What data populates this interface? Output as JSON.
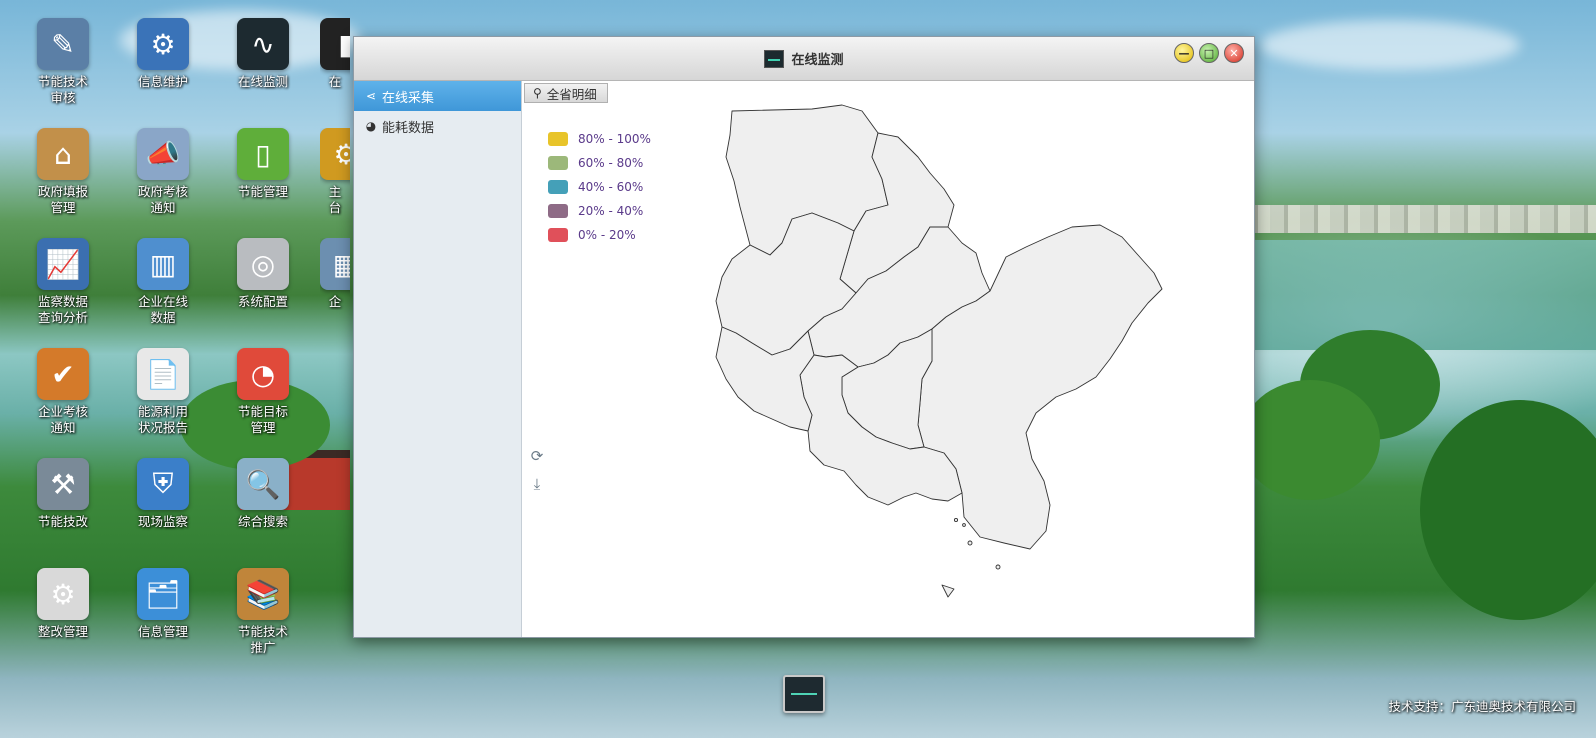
{
  "desktop": {
    "icons": [
      {
        "label": "节能技术\n审核",
        "icon": "document-pen-icon",
        "color": "#5b7fa6",
        "glyph": "✎"
      },
      {
        "label": "信息维护",
        "icon": "gears-icon",
        "color": "#3a73b8",
        "glyph": "⚙"
      },
      {
        "label": "在线监测",
        "icon": "monitor-icon",
        "color": "#1d2a30",
        "glyph": "∿"
      },
      {
        "label": "在",
        "icon": "monitor-icon",
        "color": "#222222",
        "glyph": "▮"
      },
      {
        "label": "政府填报\n管理",
        "icon": "government-building-icon",
        "color": "#c2904a",
        "glyph": "⌂"
      },
      {
        "label": "政府考核\n通知",
        "icon": "megaphone-icon",
        "color": "#8aa6c8",
        "glyph": "📣"
      },
      {
        "label": "节能管理",
        "icon": "battery-icon",
        "color": "#5fae3a",
        "glyph": "▯"
      },
      {
        "label": "主\n台",
        "icon": "gear-icon",
        "color": "#d09a20",
        "glyph": "⚙"
      },
      {
        "label": "监察数据\n查询分析",
        "icon": "chart-monitor-icon",
        "color": "#3b6fb0",
        "glyph": "📈"
      },
      {
        "label": "企业在线\n数据",
        "icon": "bar-chart-icon",
        "color": "#4f8fcf",
        "glyph": "▥"
      },
      {
        "label": "系统配置",
        "icon": "hard-disk-icon",
        "color": "#b9bcc0",
        "glyph": "◎"
      },
      {
        "label": "企",
        "icon": "building-icon",
        "color": "#6c8fb0",
        "glyph": "▦"
      },
      {
        "label": "企业考核\n通知",
        "icon": "clipboard-check-icon",
        "color": "#d47a2a",
        "glyph": "✔"
      },
      {
        "label": "能源利用\n状况报告",
        "icon": "report-chart-icon",
        "color": "#e8e8e8",
        "glyph": "📄"
      },
      {
        "label": "节能目标\n管理",
        "icon": "gauge-icon",
        "color": "#e04a3a",
        "glyph": "◔"
      },
      {
        "label": "节能技改",
        "icon": "tools-icon",
        "color": "#7a8a98",
        "glyph": "⚒"
      },
      {
        "label": "现场监察",
        "icon": "shield-camera-icon",
        "color": "#3b7fc9",
        "glyph": "⛨"
      },
      {
        "label": "综合搜索",
        "icon": "magnifier-icon",
        "color": "#8ab0c8",
        "glyph": "🔍"
      },
      {
        "label": "整改管理",
        "icon": "gear-document-icon",
        "color": "#d9d9d9",
        "glyph": "⚙"
      },
      {
        "label": "信息管理",
        "icon": "folder-cabinet-icon",
        "color": "#3c8fd8",
        "glyph": "🗂"
      },
      {
        "label": "节能技术\n推广",
        "icon": "books-icon",
        "color": "#c0853a",
        "glyph": "📚"
      }
    ]
  },
  "window": {
    "title": "在线监测",
    "title_icon": "monitor-icon",
    "buttons": {
      "minimize": "—",
      "maximize": "□",
      "close": "✕"
    },
    "sidebar": {
      "items": [
        {
          "label": "在线采集",
          "icon": "share-icon",
          "active": true
        },
        {
          "label": "能耗数据",
          "icon": "dashboard-icon",
          "active": false
        }
      ]
    },
    "content": {
      "tab": {
        "label": "全省明细",
        "icon": "search-icon"
      },
      "legend": [
        {
          "label": "80%  -  100%",
          "color": "#e8c42a"
        },
        {
          "label": "60%  -  80%",
          "color": "#9cb87a"
        },
        {
          "label": "40%  -  60%",
          "color": "#44a0b8"
        },
        {
          "label": "20%  -  40%",
          "color": "#8e6b86"
        },
        {
          "label": "0%  -  20%",
          "color": "#e0505a"
        }
      ],
      "tools": {
        "refresh": "refresh-icon",
        "download": "download-icon"
      }
    }
  },
  "footer": {
    "text": "技术支持：广东迪奥技术有限公司"
  },
  "taskbar": {
    "icon": "monitor-icon"
  }
}
